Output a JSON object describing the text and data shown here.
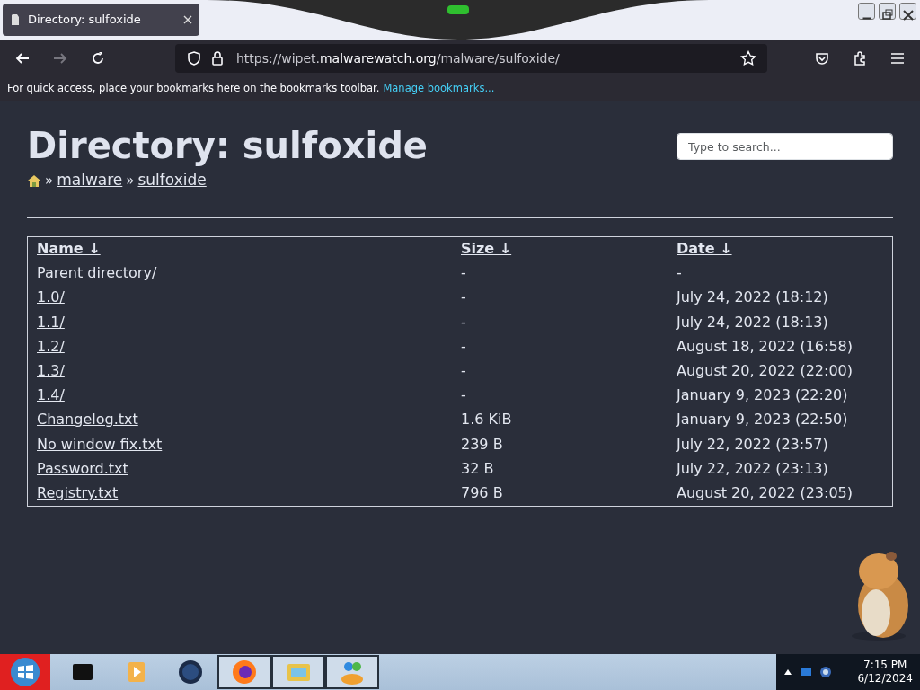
{
  "browser": {
    "tab": {
      "title": "Directory: sulfoxide",
      "selected": true
    },
    "url": {
      "scheme": "https://wipet.",
      "domain": "malwarewatch.org",
      "path": "/malware/sulfoxide/"
    },
    "bookmarks_bar": {
      "text": "For quick access, place your bookmarks here on the bookmarks toolbar.",
      "link": "Manage bookmarks..."
    }
  },
  "page": {
    "title": "Directory: sulfoxide",
    "breadcrumb": [
      {
        "label": "malware"
      },
      {
        "label": "sulfoxide"
      }
    ],
    "separator": "»",
    "search": {
      "placeholder": "Type to search..."
    },
    "table": {
      "columns": [
        "Name ↓",
        "Size ↓",
        "Date ↓"
      ],
      "rows": [
        {
          "name": "Parent directory/",
          "size": "-",
          "date": "-"
        },
        {
          "name": "1.0/",
          "size": "-",
          "date": "July 24, 2022 (18:12)"
        },
        {
          "name": "1.1/",
          "size": "-",
          "date": "July 24, 2022 (18:13)"
        },
        {
          "name": "1.2/",
          "size": "-",
          "date": "August 18, 2022 (16:58)"
        },
        {
          "name": "1.3/",
          "size": "-",
          "date": "August 20, 2022 (22:00)"
        },
        {
          "name": "1.4/",
          "size": "-",
          "date": "January 9, 2023 (22:20)"
        },
        {
          "name": "Changelog.txt",
          "size": "1.6 KiB",
          "date": "January 9, 2023 (22:50)"
        },
        {
          "name": "No window fix.txt",
          "size": "239 B",
          "date": "July 22, 2022 (23:57)"
        },
        {
          "name": "Password.txt",
          "size": "32 B",
          "date": "July 22, 2022 (23:13)"
        },
        {
          "name": "Registry.txt",
          "size": "796 B",
          "date": "August 20, 2022 (23:05)"
        }
      ]
    }
  },
  "taskbar": {
    "apps": [
      {
        "kind": "box",
        "pinned_open": false
      },
      {
        "kind": "media",
        "pinned_open": false
      },
      {
        "kind": "globe",
        "pinned_open": false
      },
      {
        "kind": "firefox",
        "pinned_open": true
      },
      {
        "kind": "folder",
        "pinned_open": true
      },
      {
        "kind": "people",
        "pinned_open": true
      }
    ],
    "time": "7:15 PM",
    "date": "6/12/2024"
  }
}
